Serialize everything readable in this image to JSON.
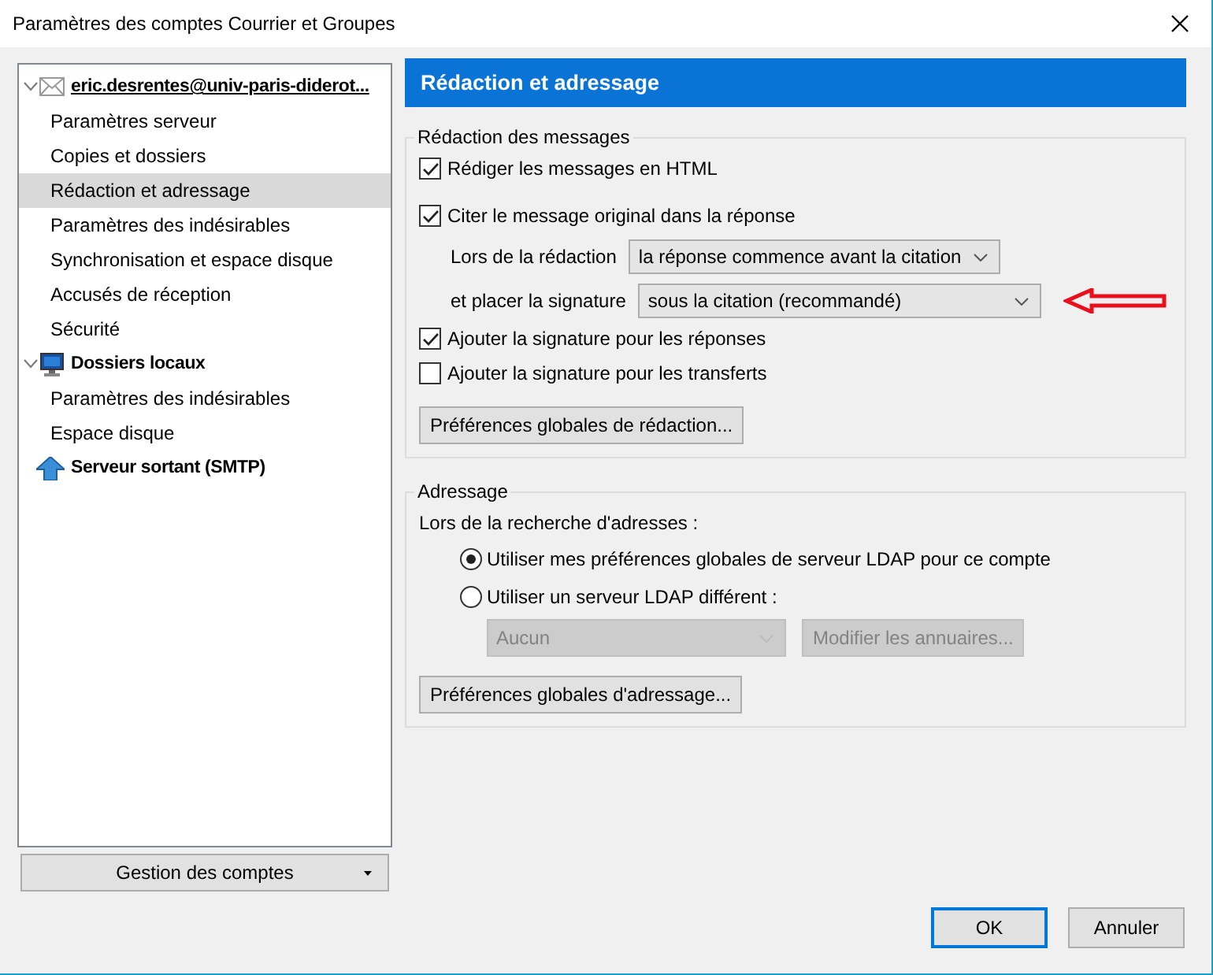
{
  "window": {
    "title": "Paramètres des comptes Courrier et Groupes"
  },
  "sidebar": {
    "accounts": [
      {
        "name": "eric.desrentes@univ-paris-diderot...",
        "kind": "mail",
        "expanded": true,
        "focused": true,
        "children": [
          {
            "label": "Paramètres serveur",
            "selected": false
          },
          {
            "label": "Copies et dossiers",
            "selected": false
          },
          {
            "label": "Rédaction et adressage",
            "selected": true
          },
          {
            "label": "Paramètres des indésirables",
            "selected": false
          },
          {
            "label": "Synchronisation et espace disque",
            "selected": false
          },
          {
            "label": "Accusés de réception",
            "selected": false
          },
          {
            "label": "Sécurité",
            "selected": false
          }
        ]
      },
      {
        "name": "Dossiers locaux",
        "kind": "local",
        "expanded": true,
        "focused": false,
        "children": [
          {
            "label": "Paramètres des indésirables",
            "selected": false
          },
          {
            "label": "Espace disque",
            "selected": false
          }
        ]
      },
      {
        "name": "Serveur sortant (SMTP)",
        "kind": "smtp",
        "focused": false
      }
    ],
    "manage_button": "Gestion des comptes"
  },
  "panel": {
    "title": "Rédaction et adressage",
    "composition": {
      "legend": "Rédaction des messages",
      "items": [
        {
          "kind": "checkbox",
          "label": "Rédiger les messages en HTML",
          "checked": true
        },
        {
          "kind": "checkbox",
          "label": "Citer le message original dans la réponse",
          "checked": true
        },
        {
          "kind": "select",
          "label": "Lors de la rédaction",
          "value": "la réponse commence avant la citation",
          "annotated": false
        },
        {
          "kind": "select",
          "label": "et placer la signature",
          "value": "sous la citation (recommandé)",
          "annotated": true
        },
        {
          "kind": "checkbox",
          "label": "Ajouter la signature pour les réponses",
          "checked": true
        },
        {
          "kind": "checkbox",
          "label": "Ajouter la signature pour les transferts",
          "checked": false
        },
        {
          "kind": "button",
          "label": "Préférences globales de rédaction..."
        }
      ]
    },
    "addressing": {
      "legend": "Adressage",
      "items": [
        {
          "kind": "text",
          "label": "Lors de la recherche d'adresses :"
        },
        {
          "kind": "radio",
          "label": "Utiliser mes préférences globales de serveur LDAP pour ce compte",
          "selected": true
        },
        {
          "kind": "radio",
          "label": "Utiliser un serveur LDAP différent :",
          "selected": false
        },
        {
          "kind": "ldap",
          "value": "Aucun",
          "button": "Modifier les annuaires...",
          "disabled": true
        },
        {
          "kind": "button",
          "label": "Préférences globales d'adressage..."
        }
      ]
    }
  },
  "buttons": [
    {
      "label": "OK",
      "default": true
    },
    {
      "label": "Annuler",
      "default": false
    }
  ]
}
